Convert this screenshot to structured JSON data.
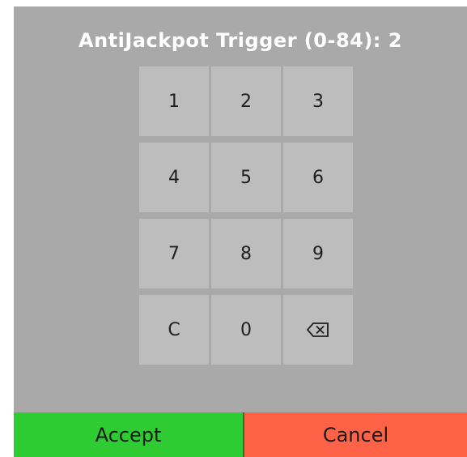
{
  "dialog": {
    "title": "AntiJackpot Trigger (0-84): 2"
  },
  "keypad": {
    "keys": [
      "1",
      "2",
      "3",
      "4",
      "5",
      "6",
      "7",
      "8",
      "9",
      "C",
      "0"
    ],
    "backspace_icon": "backspace-icon"
  },
  "footer": {
    "accept_label": "Accept",
    "cancel_label": "Cancel"
  },
  "colors": {
    "dialog_background": "#a9a9a9",
    "key_background": "#bdbdbd",
    "accept": "#2ecc32",
    "cancel": "#ff6347"
  }
}
